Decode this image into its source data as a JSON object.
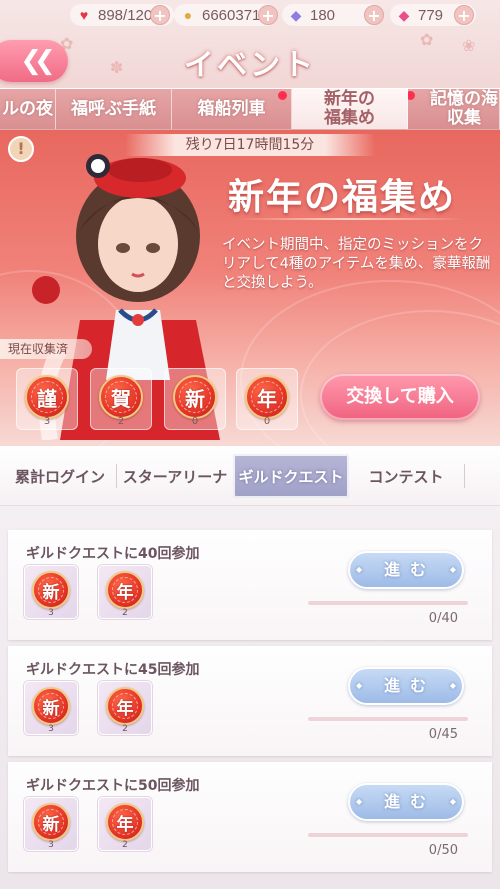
{
  "header": {
    "title": "イベント",
    "resources": {
      "stamina": "898/120",
      "gold": "6660371",
      "diamond_blue": "180",
      "diamond_pink": "779"
    },
    "back_icon": "double-chevron-left-icon"
  },
  "event_tabs": [
    {
      "label": "ルの夜",
      "active": false,
      "dot": false
    },
    {
      "label": "福呼ぶ手紙",
      "active": false,
      "dot": false
    },
    {
      "label": "箱船列車",
      "active": false,
      "dot": true
    },
    {
      "label": "新年の\n福集め",
      "active": true,
      "dot": false
    },
    {
      "label": "記憶の海\n収集",
      "active": false,
      "dot": true
    }
  ],
  "banner": {
    "remaining": "残り7日17時間15分",
    "event_name": "新年の福集め",
    "description": "イベント期間中、指定のミッションをクリアして4種のアイテムを集め、豪華報酬と交換しよう。",
    "collected_label": "現在収集済",
    "tokens": [
      {
        "glyph": "謹",
        "count": "3"
      },
      {
        "glyph": "賀",
        "count": "2"
      },
      {
        "glyph": "新",
        "count": "0"
      },
      {
        "glyph": "年",
        "count": "0"
      }
    ],
    "exchange_button": "交換して購入"
  },
  "quest_tabs": [
    {
      "label": "累計ログイン",
      "active": false
    },
    {
      "label": "スターアリーナ",
      "active": false
    },
    {
      "label": "ギルドクエスト",
      "active": true
    },
    {
      "label": "コンテスト",
      "active": false
    }
  ],
  "quests": [
    {
      "title": "ギルドクエストに40回参加",
      "rewards": [
        {
          "glyph": "新",
          "count": "3"
        },
        {
          "glyph": "年",
          "count": "2"
        }
      ],
      "button": "進む",
      "progress_text": "0/40",
      "progress": 0
    },
    {
      "title": "ギルドクエストに45回参加",
      "rewards": [
        {
          "glyph": "新",
          "count": "3"
        },
        {
          "glyph": "年",
          "count": "2"
        }
      ],
      "button": "進む",
      "progress_text": "0/45",
      "progress": 0
    },
    {
      "title": "ギルドクエストに50回参加",
      "rewards": [
        {
          "glyph": "新",
          "count": "3"
        },
        {
          "glyph": "年",
          "count": "2"
        }
      ],
      "button": "進む",
      "progress_text": "0/50",
      "progress": 0
    }
  ],
  "colors": {
    "accent_pink": "#f06b86",
    "banner_red": "#e8685f",
    "go_button_blue": "#9bb9e6",
    "active_tab_purple": "#9fa0c7"
  }
}
